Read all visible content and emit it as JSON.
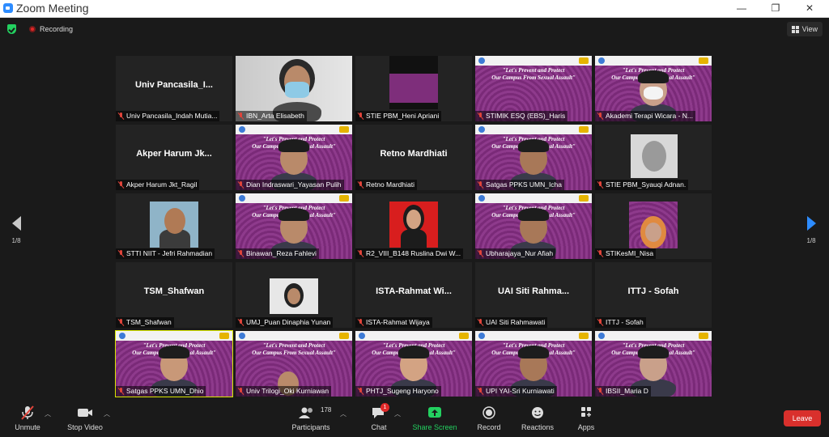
{
  "window": {
    "title": "Zoom Meeting",
    "min": "—",
    "restore": "❐",
    "close": "✕"
  },
  "topbar": {
    "recording": "Recording",
    "view": "View"
  },
  "pager": {
    "left": "1/8",
    "right": "1/8"
  },
  "tiles": [
    {
      "name": "Univ Pancasila_Indah Mutia...",
      "big": "Univ  Pancasila_I...",
      "kind": "blank"
    },
    {
      "name": "IBN_Arta Elisabeth",
      "kind": "cam-mask"
    },
    {
      "name": "STIE PBM_Heni Apriani",
      "kind": "screen"
    },
    {
      "name": "STIMIK ESQ (EBS)_Haris",
      "kind": "slide"
    },
    {
      "name": "Akademi Terapi Wicara - N...",
      "kind": "slide-person-mask"
    },
    {
      "name": "Akper Harum Jkt_Ragil",
      "big": "Akper  Harum  Jk...",
      "kind": "blank"
    },
    {
      "name": "Dian Indraswari_Yayasan Pulih",
      "kind": "slide-person"
    },
    {
      "name": "Retno Mardhiati",
      "big": "Retno Mardhiati",
      "kind": "blank"
    },
    {
      "name": "Satgas PPKS UMN_Icha",
      "kind": "slide-person"
    },
    {
      "name": "STIE PBM_Syauqi Adnan.",
      "kind": "photo-bw"
    },
    {
      "name": "STTI NIIT - Jefri Rahmadian",
      "kind": "photo"
    },
    {
      "name": "Binawan_Reza Fahlevi",
      "kind": "slide-person"
    },
    {
      "name": "R2_VIII_B148 Ruslina Dwi W...",
      "kind": "photo-red"
    },
    {
      "name": "Ubharajaya_Nur Afiah",
      "kind": "slide-person"
    },
    {
      "name": "STIKesMI_Nisa",
      "kind": "slide-small"
    },
    {
      "name": "TSM_Shafwan",
      "big": "TSM_Shafwan",
      "kind": "blank"
    },
    {
      "name": "UMJ_Puan Dinaphia Yunan",
      "kind": "small-cam"
    },
    {
      "name": "ISTA-Rahmat Wijaya",
      "big": "ISTA-Rahmat  Wi...",
      "kind": "blank"
    },
    {
      "name": "UAI Siti Rahmawati",
      "big": "UAI Siti  Rahma...",
      "kind": "blank"
    },
    {
      "name": "ITTJ - Sofah",
      "big": "ITTJ - Sofah",
      "kind": "blank"
    },
    {
      "name": "Satgas PPKS UMN_Dhio",
      "kind": "slide-person",
      "active": true
    },
    {
      "name": "Univ Trilogi_Oki Kurniawan",
      "kind": "slide-small-person"
    },
    {
      "name": "PHTJ_Sugeng Haryono",
      "kind": "slide-person"
    },
    {
      "name": "UPI YAI-Sri Kurniawati",
      "kind": "slide-person"
    },
    {
      "name": "IBSII_Maria D",
      "kind": "slide-person"
    }
  ],
  "slide_text": "\"Let's Prevent and Protect\nOur Campus From Sexual Assault\"",
  "controls": {
    "unmute": "Unmute",
    "stop_video": "Stop Video",
    "participants": "Participants",
    "participants_count": "178",
    "chat": "Chat",
    "chat_badge": "1",
    "share_screen": "Share Screen",
    "record": "Record",
    "reactions": "Reactions",
    "apps": "Apps",
    "leave": "Leave"
  },
  "colors": {
    "accent_blue": "#2d8cff",
    "share_green": "#23d160",
    "leave_red": "#d9302c",
    "active_outline": "#d8e600"
  }
}
